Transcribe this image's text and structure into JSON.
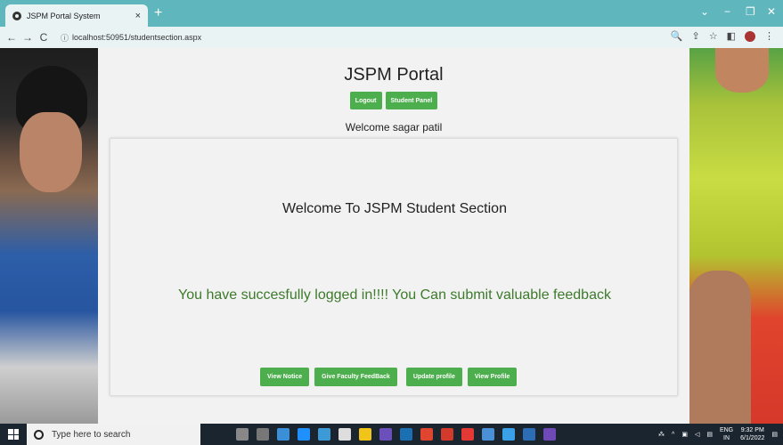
{
  "browser": {
    "tab_title": "JSPM Portal System",
    "tab_close": "×",
    "new_tab": "+",
    "url": "localhost:50951/studentsection.aspx",
    "nav_back": "←",
    "nav_forward": "→",
    "nav_reload": "C",
    "info_icon": "ⓘ",
    "window_controls": {
      "dropdown": "⌄",
      "minimize": "−",
      "restore": "❐",
      "close": "✕"
    },
    "tools": {
      "zoom": "🔍",
      "share": "⇪",
      "bookmark": "☆",
      "sidebar": "◧",
      "menu": "⋮"
    }
  },
  "page": {
    "brand": "JSPM Portal",
    "top_buttons": {
      "logout": "Logout",
      "student_panel": "Student Panel"
    },
    "welcome": "Welcome sagar patil",
    "card": {
      "title": "Welcome To JSPM Student Section",
      "message": "You have succesfully logged in!!!! You Can submit valuable feedback",
      "buttons": {
        "view_notice": "View Notice",
        "give_feedback": "Give Faculty FeedBack",
        "update_profile": "Update profile",
        "view_profile": "View Profile"
      }
    }
  },
  "taskbar": {
    "search_placeholder": "Type here to search",
    "language": "ENG",
    "region": "IN",
    "time": "9:32 PM",
    "date": "6/1/2022"
  },
  "colors": {
    "chrome": "#5fb6bd",
    "button_green": "#4cae4c",
    "message_green": "#3d7a2c",
    "taskbar": "#1b2530"
  }
}
